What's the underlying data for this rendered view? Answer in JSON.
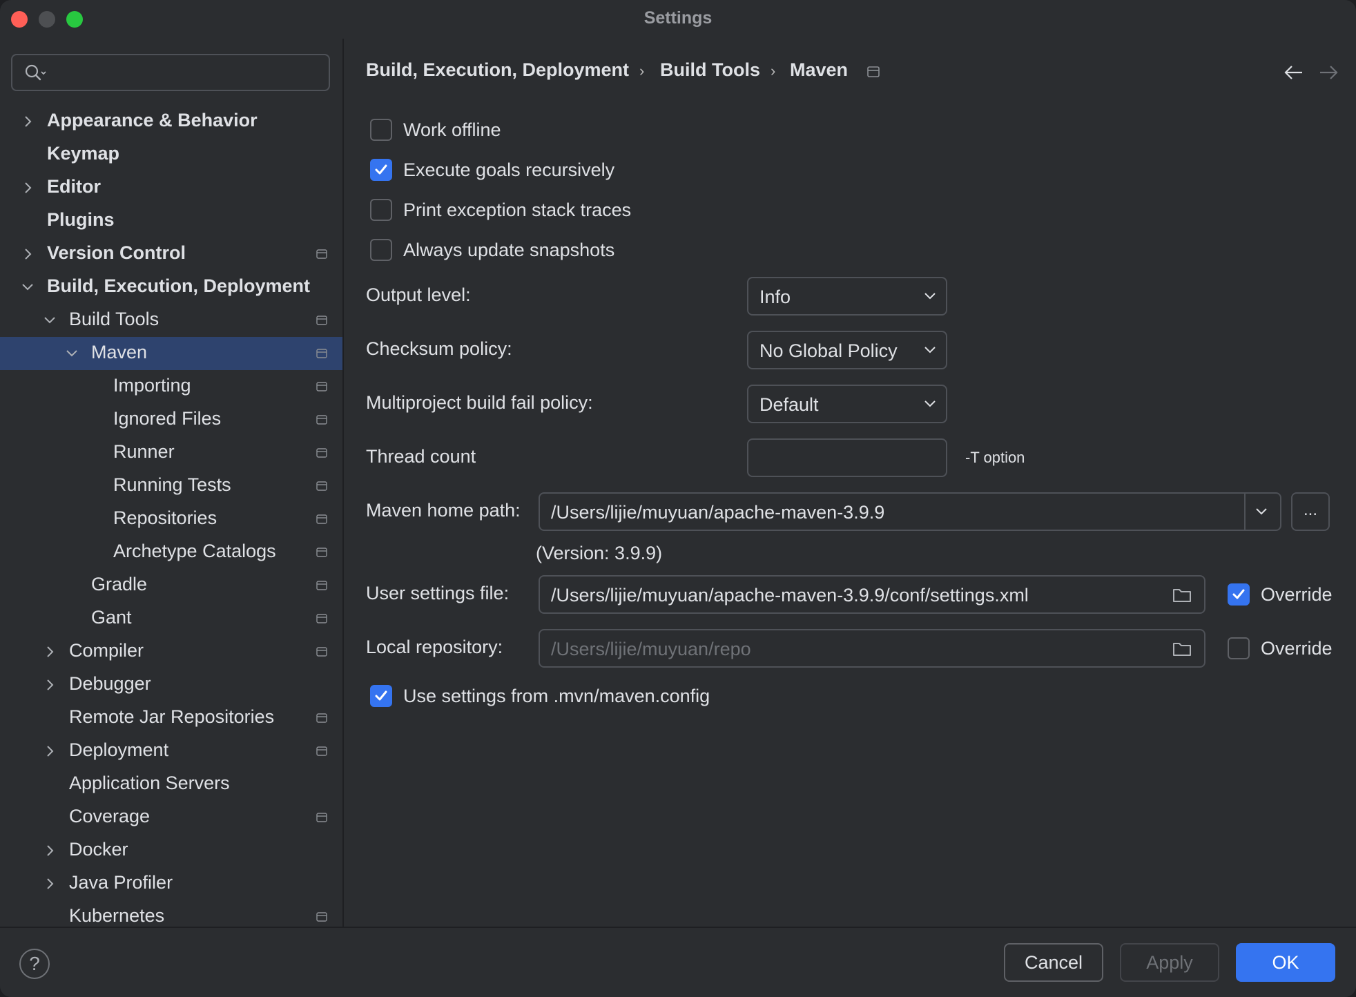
{
  "window": {
    "title": "Settings"
  },
  "search": {
    "placeholder": ""
  },
  "sidebar": {
    "items": [
      {
        "label": "Appearance & Behavior",
        "bold": true,
        "indent": 0,
        "chevron": "right",
        "project": false
      },
      {
        "label": "Keymap",
        "bold": true,
        "indent": 0,
        "chevron": "none",
        "project": false
      },
      {
        "label": "Editor",
        "bold": true,
        "indent": 0,
        "chevron": "right",
        "project": false
      },
      {
        "label": "Plugins",
        "bold": true,
        "indent": 0,
        "chevron": "none",
        "project": false
      },
      {
        "label": "Version Control",
        "bold": true,
        "indent": 0,
        "chevron": "right",
        "project": true
      },
      {
        "label": "Build, Execution, Deployment",
        "bold": true,
        "indent": 0,
        "chevron": "down",
        "project": false
      },
      {
        "label": "Build Tools",
        "bold": false,
        "indent": 1,
        "chevron": "down",
        "project": true
      },
      {
        "label": "Maven",
        "bold": false,
        "indent": 2,
        "chevron": "down",
        "project": true,
        "selected": true
      },
      {
        "label": "Importing",
        "bold": false,
        "indent": 3,
        "chevron": "none",
        "project": true
      },
      {
        "label": "Ignored Files",
        "bold": false,
        "indent": 3,
        "chevron": "none",
        "project": true
      },
      {
        "label": "Runner",
        "bold": false,
        "indent": 3,
        "chevron": "none",
        "project": true
      },
      {
        "label": "Running Tests",
        "bold": false,
        "indent": 3,
        "chevron": "none",
        "project": true
      },
      {
        "label": "Repositories",
        "bold": false,
        "indent": 3,
        "chevron": "none",
        "project": true
      },
      {
        "label": "Archetype Catalogs",
        "bold": false,
        "indent": 3,
        "chevron": "none",
        "project": true
      },
      {
        "label": "Gradle",
        "bold": false,
        "indent": 2,
        "chevron": "none",
        "project": true
      },
      {
        "label": "Gant",
        "bold": false,
        "indent": 2,
        "chevron": "none",
        "project": true
      },
      {
        "label": "Compiler",
        "bold": false,
        "indent": 1,
        "chevron": "right",
        "project": true
      },
      {
        "label": "Debugger",
        "bold": false,
        "indent": 1,
        "chevron": "right",
        "project": false
      },
      {
        "label": "Remote Jar Repositories",
        "bold": false,
        "indent": 1,
        "chevron": "none",
        "project": true
      },
      {
        "label": "Deployment",
        "bold": false,
        "indent": 1,
        "chevron": "right",
        "project": true
      },
      {
        "label": "Application Servers",
        "bold": false,
        "indent": 1,
        "chevron": "none",
        "project": false
      },
      {
        "label": "Coverage",
        "bold": false,
        "indent": 1,
        "chevron": "none",
        "project": true
      },
      {
        "label": "Docker",
        "bold": false,
        "indent": 1,
        "chevron": "right",
        "project": false
      },
      {
        "label": "Java Profiler",
        "bold": false,
        "indent": 1,
        "chevron": "right",
        "project": false
      },
      {
        "label": "Kubernetes",
        "bold": false,
        "indent": 1,
        "chevron": "none",
        "project": true
      }
    ]
  },
  "breadcrumb": {
    "part1": "Build, Execution, Deployment",
    "part2": "Build Tools",
    "part3": "Maven",
    "sep": "›"
  },
  "options": {
    "work_offline": {
      "label": "Work offline",
      "checked": false
    },
    "execute_goals": {
      "label": "Execute goals recursively",
      "checked": true
    },
    "print_exception": {
      "label": "Print exception stack traces",
      "checked": false
    },
    "always_update": {
      "label": "Always update snapshots",
      "checked": false
    },
    "use_mvn_config": {
      "label": "Use settings from .mvn/maven.config",
      "checked": true
    }
  },
  "fields": {
    "output_level": {
      "label": "Output level:",
      "value": "Info"
    },
    "checksum_policy": {
      "label": "Checksum policy:",
      "value": "No Global Policy"
    },
    "fail_policy": {
      "label": "Multiproject build fail policy:",
      "value": "Default"
    },
    "thread_count": {
      "label": "Thread count",
      "value": "",
      "hint": "-T option"
    },
    "maven_home": {
      "label": "Maven home path:",
      "value": "/Users/lijie/muyuan/apache-maven-3.9.9",
      "version": "(Version: 3.9.9)",
      "browse": "..."
    },
    "user_settings": {
      "label": "User settings file:",
      "value": "/Users/lijie/muyuan/apache-maven-3.9.9/conf/settings.xml",
      "override_label": "Override",
      "override": true
    },
    "local_repo": {
      "label": "Local repository:",
      "placeholder": "/Users/lijie/muyuan/repo",
      "override_label": "Override",
      "override": false
    }
  },
  "footer": {
    "help": "?",
    "cancel": "Cancel",
    "apply": "Apply",
    "ok": "OK"
  },
  "colors": {
    "accent": "#3574f0",
    "selection": "#2e436e",
    "background": "#2b2d30"
  }
}
